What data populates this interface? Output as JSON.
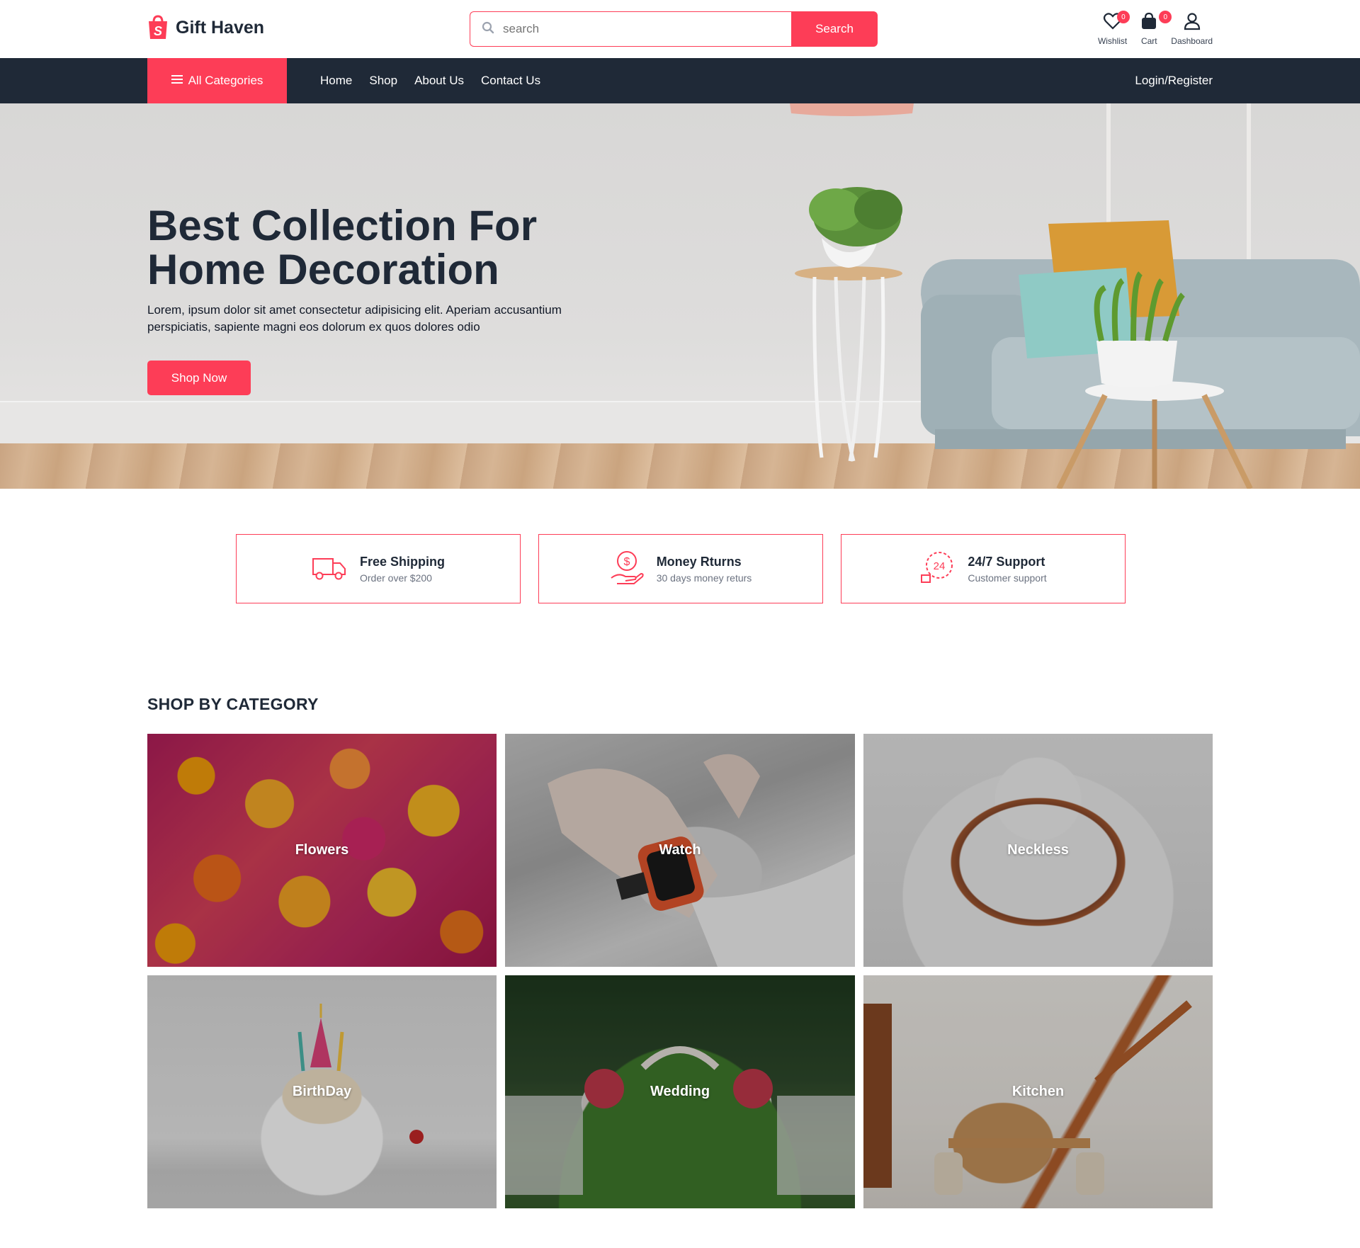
{
  "brand": {
    "name": "Gift Haven",
    "accent": "#fd3d57",
    "dark": "#1f2937"
  },
  "search": {
    "placeholder": "search",
    "button_label": "Search"
  },
  "header_icons": [
    {
      "icon": "heart-icon",
      "label": "Wishlist",
      "count": "0"
    },
    {
      "icon": "bag-icon",
      "label": "Cart",
      "count": "0"
    },
    {
      "icon": "user-icon",
      "label": "Dashboard"
    }
  ],
  "nav": {
    "all_categories": "All Categories",
    "links": [
      "Home",
      "Shop",
      "About Us",
      "Contact Us"
    ],
    "login": "Login/Register"
  },
  "hero": {
    "title": "Best Collection For Home Decoration",
    "description": "Lorem, ipsum dolor sit amet consectetur adipisicing elit. Aperiam accusantium perspiciatis, sapiente magni eos dolorum ex quos dolores odio",
    "button": "Shop Now"
  },
  "features": [
    {
      "icon": "truck-icon",
      "title": "Free Shipping",
      "subtitle": "Order over $200"
    },
    {
      "icon": "money-hand-icon",
      "title": "Money Rturns",
      "subtitle": "30 days money returs"
    },
    {
      "icon": "support-24-icon",
      "title": "24/7 Support",
      "subtitle": "Customer support"
    }
  ],
  "categories": {
    "heading": "SHOP BY CATEGORY",
    "items": [
      "Flowers",
      "Watch",
      "Neckless",
      "BirthDay",
      "Wedding",
      "Kitchen"
    ]
  }
}
